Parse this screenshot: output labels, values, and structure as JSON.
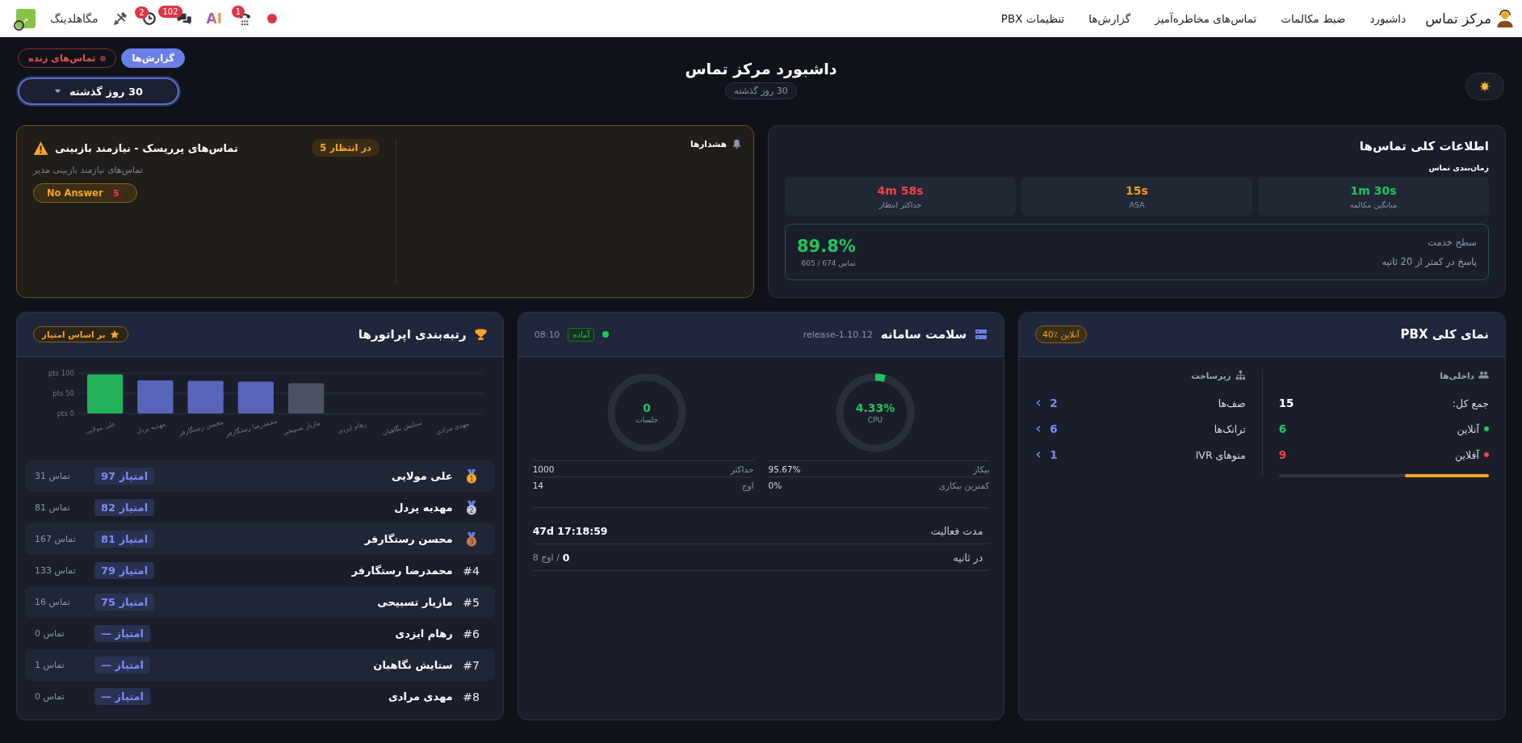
{
  "topbar": {
    "brand": "مرکز تماس",
    "nav": [
      {
        "label": "داشبورد"
      },
      {
        "label": "ضبط مکالمات"
      },
      {
        "label": "تماس‌های مخاطره‌آمیز"
      },
      {
        "label": "گزارش‌ها"
      },
      {
        "label": "تنظیمات PBX"
      }
    ],
    "call_badge": "1",
    "ai_logo": "AI",
    "message_badge": "102",
    "alarm_badge": "2",
    "company": "مگاهلدینگ",
    "avatar_letter": "م"
  },
  "header": {
    "title": "داشبورد مرکز تماس",
    "subtitle": "30 روز گذشته",
    "tabs": [
      {
        "label": "گزارش‌ها",
        "selected": true
      },
      {
        "label": "تماس‌های زنده",
        "selected": false
      }
    ],
    "period": "30 روز گذشته"
  },
  "call_stats": {
    "title": "اطلاعات کلی تماس‌ها",
    "section": "زمان‌بندی تماس",
    "metrics": [
      {
        "value": "1m 30s",
        "label": "میانگین مکالمه",
        "color": "#22c55e"
      },
      {
        "value": "15s",
        "label": "ASA",
        "color": "#f59e0b"
      },
      {
        "value": "4m 58s",
        "label": "حداکثر انتظار",
        "color": "#ef4444"
      }
    ],
    "service_level": {
      "title": "سطح خدمت",
      "description": "پاسخ در کمتر از 20 ثانیه",
      "value": "89.8%",
      "detail": "605 / 674 تماس"
    }
  },
  "alerts": {
    "title": "هشدارها",
    "items": [
      {
        "title": "تماس‌های پرریسک - نیازمند بازبینی",
        "pending": "در انتظار 5",
        "description": "تماس‌های نیازمند بازبینی مدیر",
        "tags": [
          {
            "label": "No Answer",
            "count": "5"
          }
        ]
      }
    ]
  },
  "pbx": {
    "title": "نمای کلی PBX",
    "online_badge": "40٪ آنلاین",
    "extensions": {
      "title": "داخلی‌ها",
      "total_label": "جمع کل:",
      "total": "15",
      "rows": [
        {
          "label": "آنلاین",
          "value": "6",
          "color": "#22c55e"
        },
        {
          "label": "آفلاین",
          "value": "9",
          "color": "#ef4444"
        }
      ],
      "level": 0.4
    },
    "infrastructure": {
      "title": "زیرساخت",
      "items": [
        {
          "label": "صف‌ها",
          "value": "2"
        },
        {
          "label": "ترانک‌ها",
          "value": "6"
        },
        {
          "label": "منوهای IVR",
          "value": "1"
        }
      ]
    }
  },
  "health": {
    "title": "سلامت سامانه",
    "version": "release-1.10.12",
    "status": "آماده",
    "time": "08:10",
    "gauges": [
      {
        "value": "4.33%",
        "label": "CPU",
        "level": 0.0433
      },
      {
        "value": "0",
        "label": "جلسات",
        "level": 0
      }
    ],
    "stats": [
      [
        {
          "label": "بیکار",
          "value": "95.67%"
        },
        {
          "label": "کمترین بیکاری",
          "value": "0%"
        }
      ],
      [
        {
          "label": "حداکثر",
          "value": "1000"
        },
        {
          "label": "اوج",
          "value": "14"
        }
      ]
    ],
    "uptime_label": "مدت فعالیت",
    "uptime": "47d 17:18:59",
    "rate_label": "در ثانیه",
    "rate": "0",
    "rate_peak": "/ اوج 8"
  },
  "ranking": {
    "title": "رتبه‌بندی اپراتورها",
    "sort_badge": "بر اساس امتیاز",
    "chart_data": {
      "type": "bar",
      "categories": [
        "علی مولایی",
        "مهدیه پردل",
        "محسن رستگارفر",
        "محمدرضا رستگارفر",
        "مازیار تسبیحی",
        "رهام ایزدی",
        "ستایش نگاهبان",
        "مهدی مرادی"
      ],
      "stacked": true,
      "series": [
        {
          "color": "#22b35a",
          "values": [
            97,
            null,
            null,
            null,
            null,
            null,
            null,
            null
          ]
        },
        {
          "color": "#5865b8",
          "values": [
            null,
            82,
            81,
            79,
            null,
            null,
            null,
            null
          ]
        },
        {
          "color": "#4b5262",
          "values": [
            null,
            null,
            null,
            null,
            75,
            null,
            null,
            null
          ]
        }
      ],
      "ylim": [
        0,
        100
      ],
      "yticks": [
        {
          "value": 0,
          "label": "0 pts"
        },
        {
          "value": 50,
          "label": "50 pts"
        },
        {
          "value": 100,
          "label": "100 pts"
        }
      ]
    },
    "operators": [
      {
        "kind": "medal",
        "rank": "1",
        "name": "علی مولایی",
        "score": "97 امتیاز",
        "calls": "31 تماس"
      },
      {
        "kind": "medal",
        "rank": "2",
        "name": "مهدیه پردل",
        "score": "82 امتیاز",
        "calls": "81 تماس"
      },
      {
        "kind": "medal",
        "rank": "3",
        "name": "محسن رستگارفر",
        "score": "81 امتیاز",
        "calls": "167 تماس"
      },
      {
        "kind": "plain",
        "rank": "#4",
        "name": "محمدرضا رستگارفر",
        "score": "79 امتیاز",
        "calls": "133 تماس"
      },
      {
        "kind": "plain",
        "rank": "#5",
        "name": "مازیار تسبیحی",
        "score": "75 امتیاز",
        "calls": "16 تماس"
      },
      {
        "kind": "plain",
        "rank": "#6",
        "name": "رهام ایزدی",
        "score": "— امتیاز",
        "calls": "0 تماس"
      },
      {
        "kind": "plain",
        "rank": "#7",
        "name": "ستایش نگاهبان",
        "score": "— امتیاز",
        "calls": "1 تماس"
      },
      {
        "kind": "plain",
        "rank": "#8",
        "name": "مهدی مرادی",
        "score": "— امتیاز",
        "calls": "0 تماس"
      }
    ]
  }
}
